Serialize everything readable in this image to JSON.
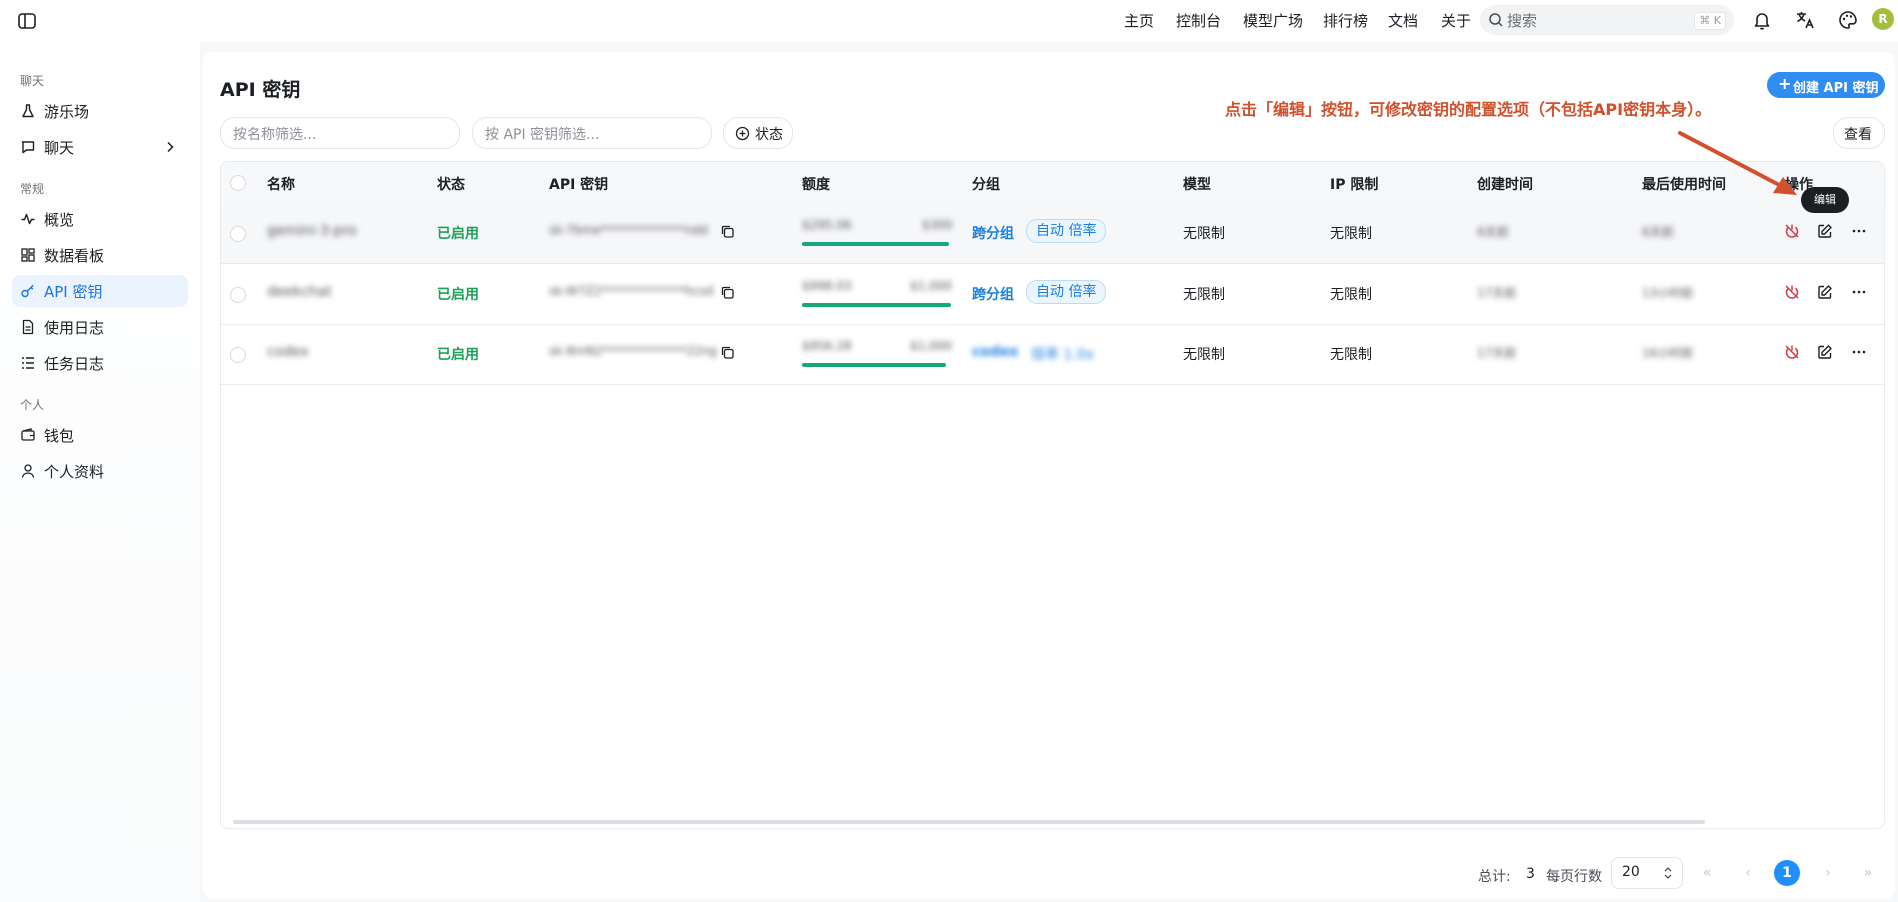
{
  "topbar": {
    "nav": [
      "主页",
      "控制台",
      "模型广场",
      "排行榜",
      "文档",
      "关于"
    ],
    "search_placeholder": "搜索",
    "search_shortcut": "⌘ K",
    "avatar_letter": "R"
  },
  "sidebar": {
    "sections": [
      {
        "title": "聊天",
        "items": [
          {
            "label": "游乐场",
            "icon": "flask-icon"
          },
          {
            "label": "聊天",
            "icon": "chat-icon",
            "expandable": true
          }
        ]
      },
      {
        "title": "常规",
        "items": [
          {
            "label": "概览",
            "icon": "activity-icon"
          },
          {
            "label": "数据看板",
            "icon": "dashboard-icon"
          },
          {
            "label": "API 密钥",
            "icon": "key-icon",
            "active": true
          },
          {
            "label": "使用日志",
            "icon": "log-icon"
          },
          {
            "label": "任务日志",
            "icon": "task-list-icon"
          }
        ]
      },
      {
        "title": "个人",
        "items": [
          {
            "label": "钱包",
            "icon": "wallet-icon"
          },
          {
            "label": "个人资料",
            "icon": "user-icon"
          }
        ]
      }
    ]
  },
  "page": {
    "title": "API 密钥",
    "create_button": "创建 API 密钥",
    "annotation": "点击「编辑」按钮，可修改密钥的配置选项（不包括API密钥本身）。",
    "filter_name_placeholder": "按名称筛选...",
    "filter_key_placeholder": "按 API 密钥筛选...",
    "status_button": "状态",
    "view_button": "查看",
    "tooltip": "编辑"
  },
  "table": {
    "columns": [
      "名称",
      "状态",
      "API 密钥",
      "额度",
      "分组",
      "模型",
      "IP 限制",
      "创建时间",
      "最后使用时间",
      "操作"
    ],
    "rows": [
      {
        "name": "gemini-3-pro",
        "status": "已启用",
        "key": "sk-7bme**************ndd",
        "quota_used": "$295.06",
        "quota_total": "$300",
        "quota_fraction": 0.98,
        "group": "跨分组",
        "group_tag": "自动 倍率",
        "models": "无限制",
        "ip": "无限制",
        "created": "6天前",
        "last_used": "6天前"
      },
      {
        "name": "deekchat",
        "status": "已启用",
        "key": "sk-W7Z2**************hcsd",
        "quota_used": "$998.03",
        "quota_total": "$1,000",
        "quota_fraction": 0.99,
        "group": "跨分组",
        "group_tag": "自动 倍率",
        "models": "无限制",
        "ip": "无限制",
        "created": "17天前",
        "last_used": "13小时前"
      },
      {
        "name": "codex",
        "status": "已启用",
        "key": "sk-8mN2**************22ng",
        "quota_used": "$956.28",
        "quota_total": "$1,000",
        "quota_fraction": 0.96,
        "group": "codex",
        "group_tag": "倍率 1.0x",
        "models": "无限制",
        "ip": "无限制",
        "created": "17天前",
        "last_used": "16小时前"
      }
    ]
  },
  "footer": {
    "total_label": "总计:",
    "total": "3",
    "per_page_label": "每页行数",
    "per_page": "20",
    "current_page": "1"
  }
}
